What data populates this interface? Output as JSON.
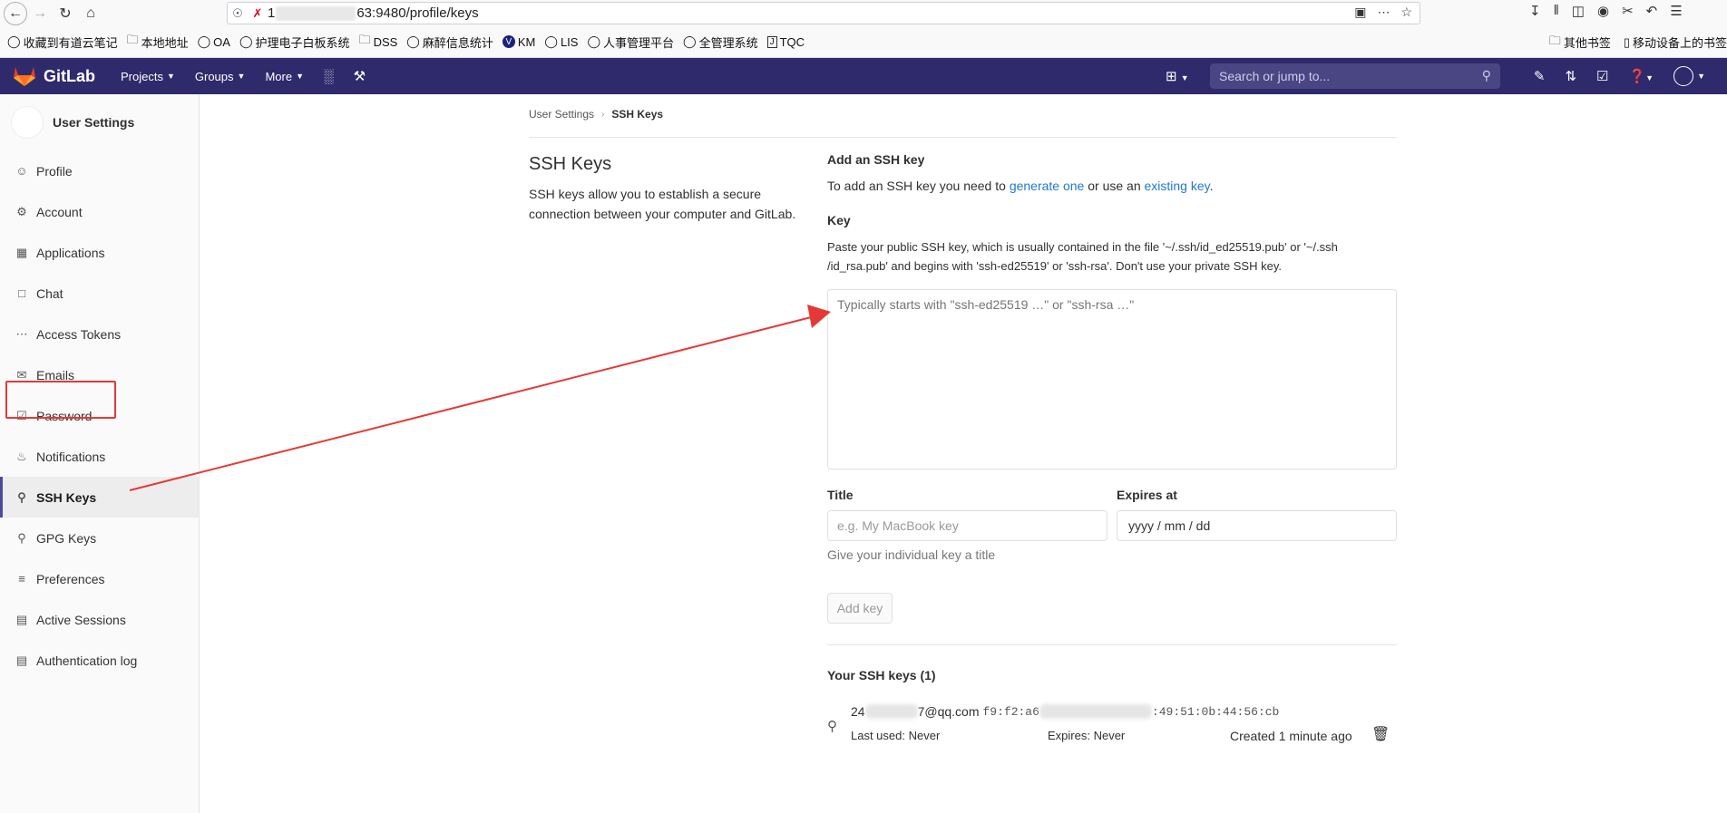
{
  "browser": {
    "url_start": "1",
    "url_end": "63:9480/profile/keys",
    "bookmarks": [
      {
        "label": "收藏到有道云笔记",
        "icon": "globe-icon"
      },
      {
        "label": "本地地址",
        "icon": "folder-icon"
      },
      {
        "label": "OA",
        "icon": "globe-icon"
      },
      {
        "label": "护理电子白板系统",
        "icon": "globe-icon"
      },
      {
        "label": "DSS",
        "icon": "folder-icon"
      },
      {
        "label": "麻醉信息统计",
        "icon": "globe-icon"
      },
      {
        "label": "KM",
        "icon": "v-icon"
      },
      {
        "label": "LIS",
        "icon": "globe-icon"
      },
      {
        "label": "人事管理平台",
        "icon": "globe-icon"
      },
      {
        "label": "全管理系统",
        "icon": "globe-icon"
      },
      {
        "label": "TQC",
        "icon": "j-icon"
      }
    ],
    "bookmarks_right": [
      {
        "label": "其他书签"
      },
      {
        "label": "移动设备上的书签"
      }
    ]
  },
  "topnav": {
    "brand": "GitLab",
    "projects": "Projects",
    "groups": "Groups",
    "more": "More",
    "search_placeholder": "Search or jump to..."
  },
  "sidebar": {
    "title": "User Settings",
    "items": [
      {
        "label": "Profile"
      },
      {
        "label": "Account"
      },
      {
        "label": "Applications"
      },
      {
        "label": "Chat"
      },
      {
        "label": "Access Tokens"
      },
      {
        "label": "Emails"
      },
      {
        "label": "Password"
      },
      {
        "label": "Notifications"
      },
      {
        "label": "SSH Keys"
      },
      {
        "label": "GPG Keys"
      },
      {
        "label": "Preferences"
      },
      {
        "label": "Active Sessions"
      },
      {
        "label": "Authentication log"
      }
    ]
  },
  "breadcrumb": {
    "parent": "User Settings",
    "current": "SSH Keys"
  },
  "page": {
    "title": "SSH Keys",
    "description": "SSH keys allow you to establish a secure connection between your computer and GitLab."
  },
  "form": {
    "heading": "Add an SSH key",
    "intro_prefix": "To add an SSH key you need to ",
    "link_generate": "generate one",
    "intro_middle": " or use an ",
    "link_existing": "existing key",
    "intro_suffix": ".",
    "key_label": "Key",
    "key_help": "Paste your public SSH key, which is usually contained in the file '~/.ssh/id_ed25519.pub' or '~/.ssh /id_rsa.pub' and begins with 'ssh-ed25519' or 'ssh-rsa'. Don't use your private SSH key.",
    "key_placeholder": "Typically starts with \"ssh-ed25519 …\" or \"ssh-rsa …\"",
    "title_label": "Title",
    "title_placeholder": "e.g. My MacBook key",
    "title_hint": "Give your individual key a title",
    "expires_label": "Expires at",
    "expires_value": "yyyy / mm / dd",
    "add_button": "Add key"
  },
  "keys": {
    "heading": "Your SSH keys (1)",
    "items": [
      {
        "email_start": "24",
        "email_end": "7@qq.com",
        "fp_start": "f9:f2:a6",
        "fp_end": ":49:51:0b:44:56:cb",
        "last_used": "Last used: Never",
        "expires": "Expires: Never",
        "created": "Created 1 minute ago"
      }
    ]
  },
  "colors": {
    "nav_bg": "#2f2a6b",
    "link": "#1f78d1",
    "annotation": "#e53935"
  }
}
